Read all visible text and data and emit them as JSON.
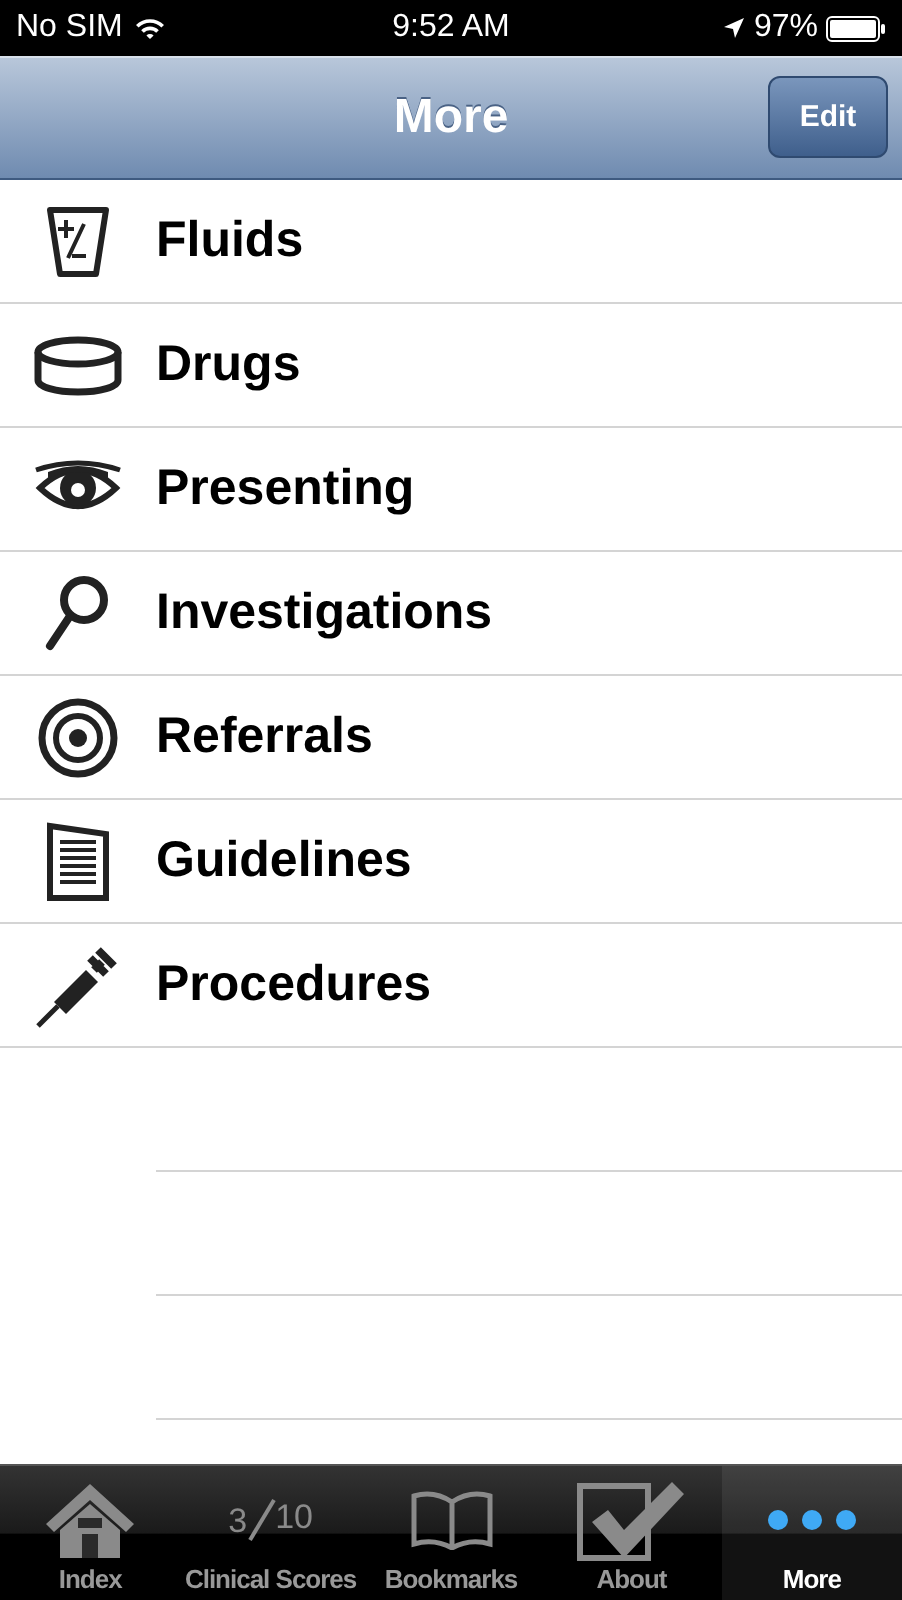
{
  "status_bar": {
    "carrier": "No SIM",
    "time": "9:52 AM",
    "battery": "97%"
  },
  "nav_bar": {
    "title": "More",
    "edit_button": "Edit"
  },
  "items": [
    {
      "label": "Fluids",
      "kind": "fluid"
    },
    {
      "label": "Drugs",
      "kind": "drug"
    },
    {
      "label": "Presenting",
      "kind": "eye"
    },
    {
      "label": "Investigations",
      "kind": "magnifier"
    },
    {
      "label": "Referrals",
      "kind": "target"
    },
    {
      "label": "Guidelines",
      "kind": "document"
    },
    {
      "label": "Procedures",
      "kind": "syringe"
    }
  ],
  "tab_bar": [
    {
      "label": "Index",
      "kind": "house",
      "selected": false
    },
    {
      "label": "Clinical Scores",
      "kind": "fraction",
      "numerator": "3",
      "denominator": "10",
      "selected": false
    },
    {
      "label": "Bookmarks",
      "kind": "book",
      "selected": false
    },
    {
      "label": "About",
      "kind": "check",
      "selected": false
    },
    {
      "label": "More",
      "kind": "dots",
      "selected": true
    }
  ]
}
